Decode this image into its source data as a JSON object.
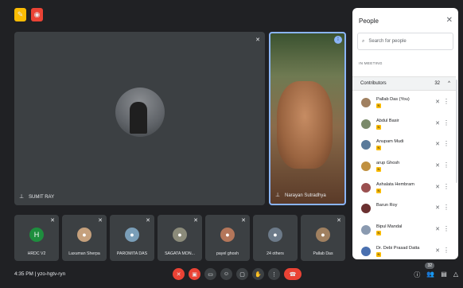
{
  "top_icons": [
    {
      "name": "note-icon",
      "color": "#fbbc04",
      "glyph": "✎"
    },
    {
      "name": "record-icon",
      "color": "#ea4335",
      "glyph": "◉"
    }
  ],
  "main_tile": {
    "name": "SUMIT RAY",
    "pin_glyph": "⊥",
    "mic_glyph": "✕"
  },
  "video_tile": {
    "name": "Narayan Sutradhya",
    "speaking_glyph": "⁞"
  },
  "thumbnails": [
    {
      "label": "HRDC V2",
      "avatar_text": "H",
      "avatar_color": "#1e8e3e"
    },
    {
      "label": "Laxuman Sherpa",
      "avatar_text": "●",
      "avatar_color": "#c5a07c"
    },
    {
      "label": "PAROMITA DAS",
      "avatar_text": "●",
      "avatar_color": "#7a9eb8"
    },
    {
      "label": "SAGATA MON...",
      "avatar_text": "●",
      "avatar_color": "#8b8b7a"
    },
    {
      "label": "payel ghosh",
      "avatar_text": "●",
      "avatar_color": "#b4765a"
    },
    {
      "label": "24 others",
      "avatar_text": "●",
      "avatar_color": "#6c7a89"
    },
    {
      "label": "Pallab Das",
      "avatar_text": "●",
      "avatar_color": "#a08060"
    }
  ],
  "bottom_bar": {
    "time_meeting": "4:35 PM  |  yzo-hgtv-ryn",
    "people_count": "32",
    "controls": [
      {
        "name": "mic-off-button",
        "glyph": "✕",
        "red": true
      },
      {
        "name": "camera-off-button",
        "glyph": "▣",
        "red": true
      },
      {
        "name": "captions-button",
        "glyph": "▭",
        "red": false
      },
      {
        "name": "emoji-button",
        "glyph": "☺",
        "red": false
      },
      {
        "name": "present-button",
        "glyph": "▢",
        "red": false
      },
      {
        "name": "raise-hand-button",
        "glyph": "✋",
        "red": false
      },
      {
        "name": "more-options-button",
        "glyph": "⋮",
        "red": false
      }
    ],
    "end_call_glyph": "☎",
    "right_icons": [
      {
        "name": "info-icon",
        "glyph": "ⓘ"
      },
      {
        "name": "people-icon",
        "glyph": "👥"
      },
      {
        "name": "chat-icon",
        "glyph": "▤"
      },
      {
        "name": "activities-icon",
        "glyph": "△"
      }
    ]
  },
  "people_panel": {
    "title": "People",
    "close_glyph": "✕",
    "search_placeholder": "Search for people",
    "section_label": "IN MEETING",
    "contributors_label": "Contributors",
    "contributors_count": "32",
    "chevron": "^",
    "participants": [
      {
        "name": "Pallab Das (You)",
        "avatar_color": "#a08060"
      },
      {
        "name": "Abdul Basir",
        "avatar_color": "#7a8a6a"
      },
      {
        "name": "Anupam Mudi",
        "avatar_color": "#5a7a9a"
      },
      {
        "name": "arup Ghosh",
        "avatar_color": "#c09040"
      },
      {
        "name": "Ashalata Hembram",
        "avatar_color": "#9a5050"
      },
      {
        "name": "Barun Roy",
        "avatar_color": "#6a3030"
      },
      {
        "name": "Bipul Mandal",
        "avatar_color": "#8a9ab0"
      },
      {
        "name": "Dr. Debi Prasad Datta",
        "avatar_color": "#4a70b0"
      }
    ]
  }
}
